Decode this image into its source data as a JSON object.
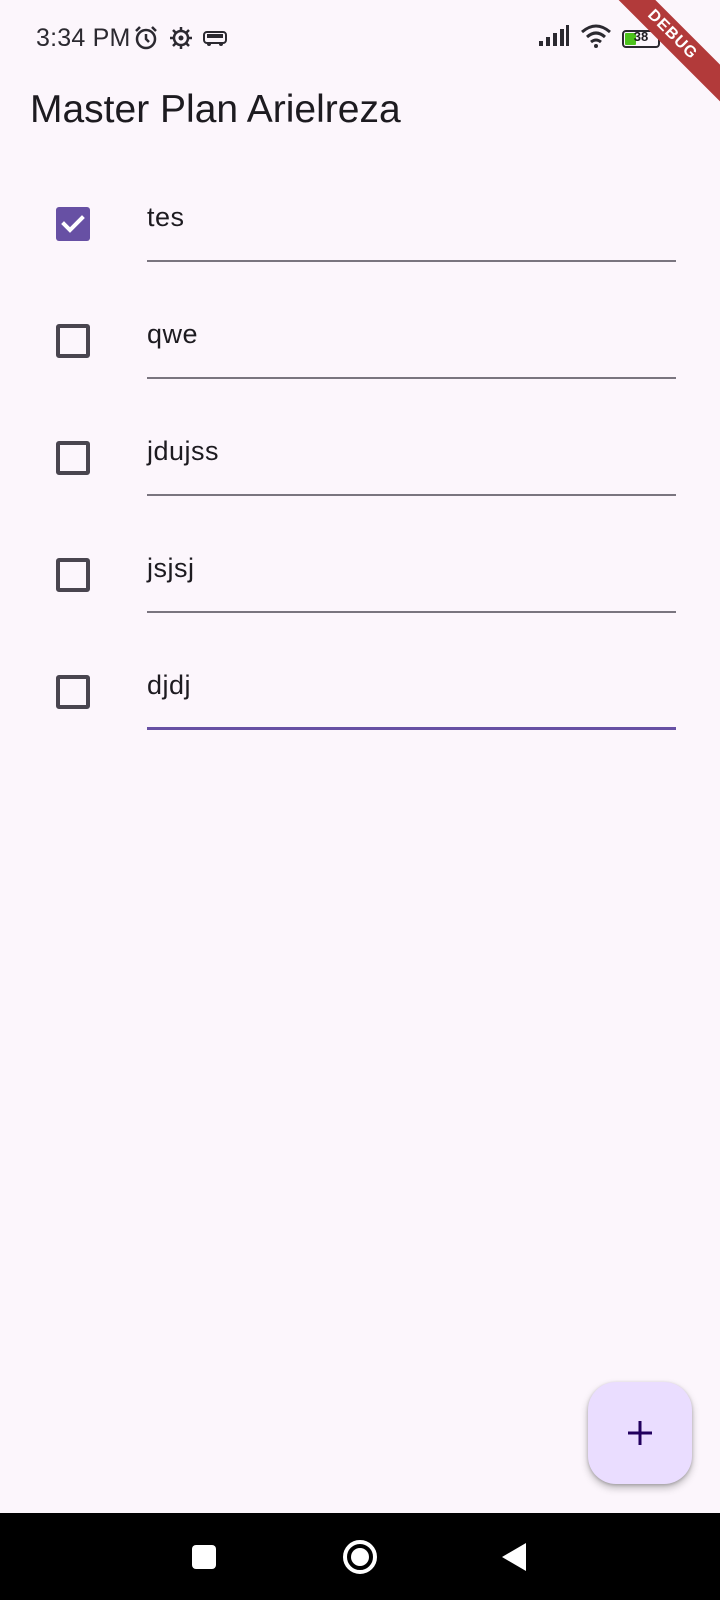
{
  "status_bar": {
    "time": "3:34 PM",
    "left_icons": [
      "alarm-icon",
      "settings-gear-icon",
      "bus-app-icon"
    ],
    "right_icons": [
      "cellular-signal-icon",
      "wifi-icon",
      "battery-icon",
      "charging-icon"
    ],
    "battery_level": "38"
  },
  "debug_banner": "DEBUG",
  "app_bar": {
    "title": "Master Plan Arielreza"
  },
  "tasks": [
    {
      "text": "tes",
      "done": true
    },
    {
      "text": "qwe",
      "done": false
    },
    {
      "text": "jdujss",
      "done": false
    },
    {
      "text": "jsjsj",
      "done": false
    },
    {
      "text": "djdj",
      "done": false,
      "focused": true
    }
  ],
  "fab": {
    "icon": "add-icon"
  },
  "nav_bar": {
    "buttons": [
      "recents-square-icon",
      "home-circle-icon",
      "back-triangle-icon"
    ]
  },
  "colors": {
    "primary": "#6750a4",
    "fab_background": "#eaddff",
    "surface": "#fcf6fc",
    "debug_ribbon": "#b23a3a"
  }
}
